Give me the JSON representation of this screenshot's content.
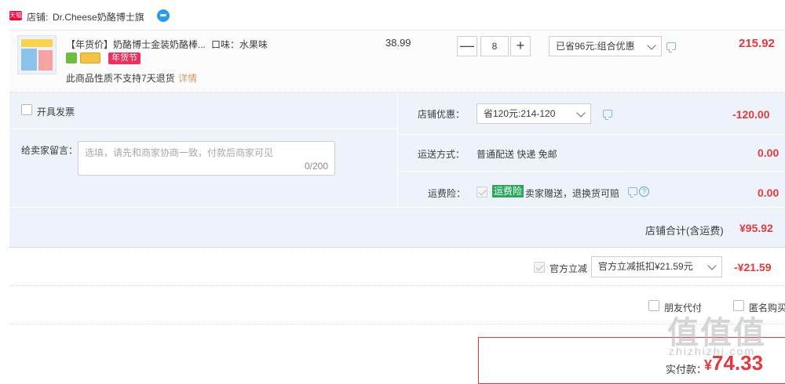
{
  "shop": {
    "badge": "天猫",
    "label": "店铺:",
    "name": "Dr.Cheese奶酪博士旗"
  },
  "item": {
    "title": "【年货价】奶酪博士金装奶酪棒...",
    "tag": "年货节",
    "no_return_note": "此商品性质不支持7天退货",
    "details_link": "详情",
    "sku": "口味：水果味",
    "unit_price": "38.99",
    "quantity": "8",
    "qty_minus": "—",
    "qty_plus": "+",
    "promo": "已省96元:组合优惠",
    "total": "215.92"
  },
  "invoice": {
    "label": "开具发票"
  },
  "message": {
    "label": "给卖家留言：",
    "placeholder": "选填，请先和商家协商一致，付款后商家可见",
    "counter": "0/200"
  },
  "shop_discount": {
    "label": "店铺优惠：",
    "selected": "省120元:214-120",
    "amount": "-120.00"
  },
  "shipping": {
    "label": "运送方式：",
    "value": "普通配送 快递 免邮",
    "amount": "0.00"
  },
  "insurance": {
    "label": "运费险：",
    "tag": "运费险",
    "desc": "卖家赠送，退换货可赔",
    "help": "?",
    "amount": "0.00"
  },
  "shop_total": {
    "label": "店铺合计(含运费)",
    "amount": "¥95.92"
  },
  "official_discount": {
    "label": "官方立减",
    "selected": "官方立减抵扣¥21.59元",
    "amount": "-¥21.59"
  },
  "options": {
    "friend_pay": "朋友代付",
    "anonymous": "匿名购买"
  },
  "payment": {
    "label": "实付款：",
    "currency": "¥",
    "amount": "74.33"
  },
  "watermark": {
    "logo": "值值值",
    "text": "zhizhizhi.com"
  },
  "colors": {
    "accent_red": "#e4393c",
    "panel_bg": "#eef3fb",
    "insurance_green": "#27a85a",
    "tag_pink": "#f22e5a"
  }
}
